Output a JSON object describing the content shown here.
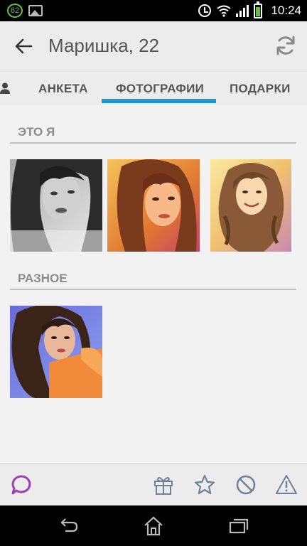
{
  "status_bar": {
    "badge": "62",
    "time": "10:24",
    "battery_level": 0.7,
    "icons": [
      "notification-badge",
      "gallery-icon",
      "alarm-icon",
      "wifi-icon",
      "signal-icon",
      "battery-icon"
    ]
  },
  "app_bar": {
    "title": "Маришка, 22",
    "icons": [
      "back-arrow-icon",
      "refresh-icon"
    ]
  },
  "tabs": {
    "items": [
      {
        "label": "АНКЕТА"
      },
      {
        "label": "ФОТОГРАФИИ",
        "selected": true
      },
      {
        "label": "ПОДАРКИ"
      }
    ],
    "accent": "#1e96d2"
  },
  "sections": [
    {
      "title": "ЭТО Я",
      "photos": [
        "photo-bw",
        "photo-warm",
        "photo-golden"
      ]
    },
    {
      "title": "РАЗНОЕ",
      "photos": [
        "photo-blue-orange"
      ]
    }
  ],
  "bottom_bar": {
    "icons": [
      "chat-bubble-icon",
      "gift-icon",
      "star-icon",
      "block-icon",
      "warning-icon"
    ],
    "chat_color": "#9b3fb5"
  },
  "nav_bar": {
    "icons": [
      "nav-back-icon",
      "nav-home-icon",
      "nav-recents-icon"
    ]
  }
}
